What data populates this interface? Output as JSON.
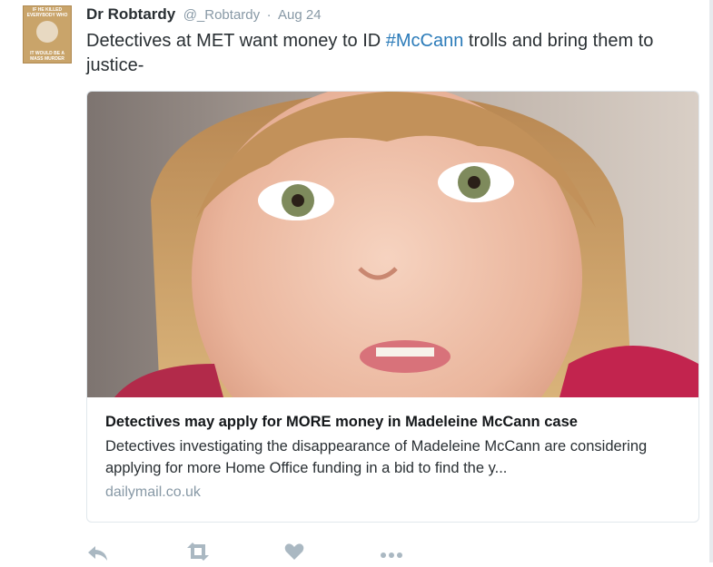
{
  "tweet": {
    "author_name": "Dr Robtardy",
    "handle": "@_Robtardy",
    "separator": "·",
    "time": "Aug 24",
    "text_before": "Detectives at MET want money to ID ",
    "hashtag": "#McCann",
    "text_after": " trolls and bring them to justice-"
  },
  "avatar": {
    "caption_top": "IF HE KILLED EVERYBODY WHO HATES YOU",
    "caption_bottom": "IT WOULD BE A MASS MURDER"
  },
  "card": {
    "title": "Detectives may apply for MORE money in Madeleine McCann case",
    "description": "Detectives investigating the disappearance of Madeleine McCann are considering applying for more Home Office funding in a bid to find the y...",
    "domain": "dailymail.co.uk"
  },
  "actions": {
    "icons": [
      "reply-icon",
      "retweet-icon",
      "like-icon",
      "more-icon"
    ]
  },
  "colors": {
    "link": "#2b7bb9",
    "muted": "#8899a6",
    "text": "#292f33",
    "border": "#e1e8ed"
  }
}
